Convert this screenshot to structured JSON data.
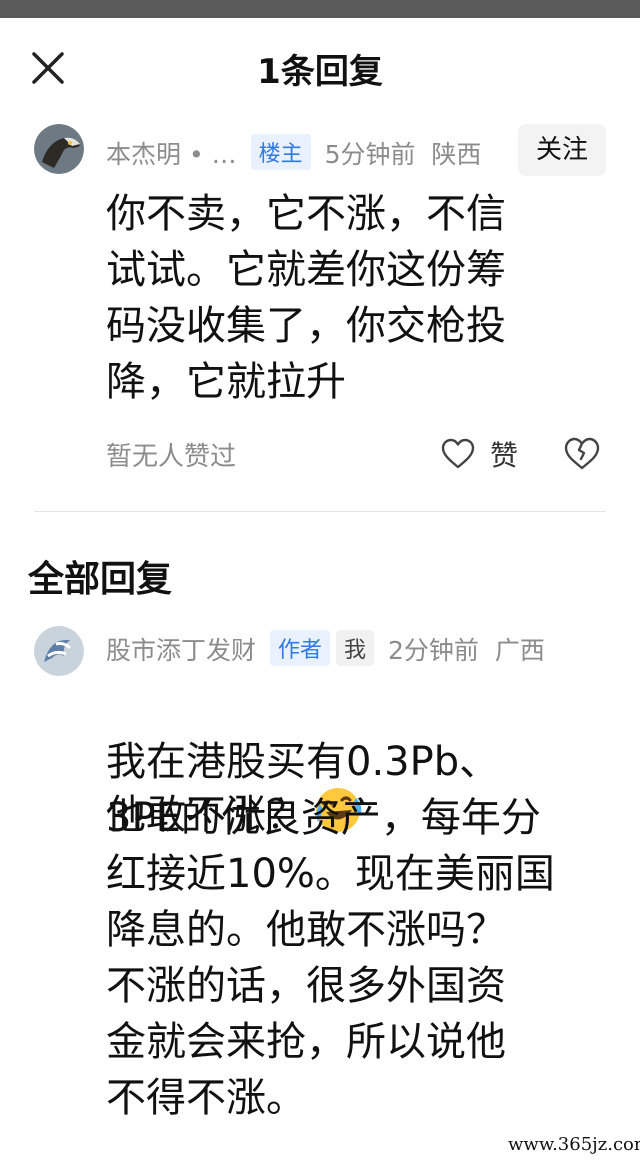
{
  "header": {
    "title": "1条回复",
    "close_icon": "close-icon"
  },
  "comment": {
    "author": "本杰明 • …",
    "badge": "楼主",
    "time": "5分钟前",
    "location": "陕西",
    "follow_label": "关注",
    "text": "你不卖，它不涨，不信\n试试。它就差你这份筹\n码没收集了，你交枪投\n降，它就拉升",
    "likes_text": "暂无人赞过",
    "like_label": "赞"
  },
  "section": {
    "title": "全部回复"
  },
  "reply": {
    "author": "股市添丁发财",
    "badge_author": "作者",
    "badge_me": "我",
    "time": "2分钟前",
    "location": "广西",
    "line1": "他敢不涨？",
    "emoji": "laughing-crying-emoji",
    "text": "我在港股买有0.3Pb、\n3PE的优良资产，每年分\n红接近10%。现在美丽国\n降息的。他敢不涨吗？\n不涨的话，很多外国资\n金就会来抢，所以说他\n不得不涨。"
  },
  "watermark": "www.365jz.com",
  "colors": {
    "accent": "#2f7be0",
    "meta_gray": "#8c8c8c",
    "tag_blue_bg": "#e8f1fd"
  }
}
